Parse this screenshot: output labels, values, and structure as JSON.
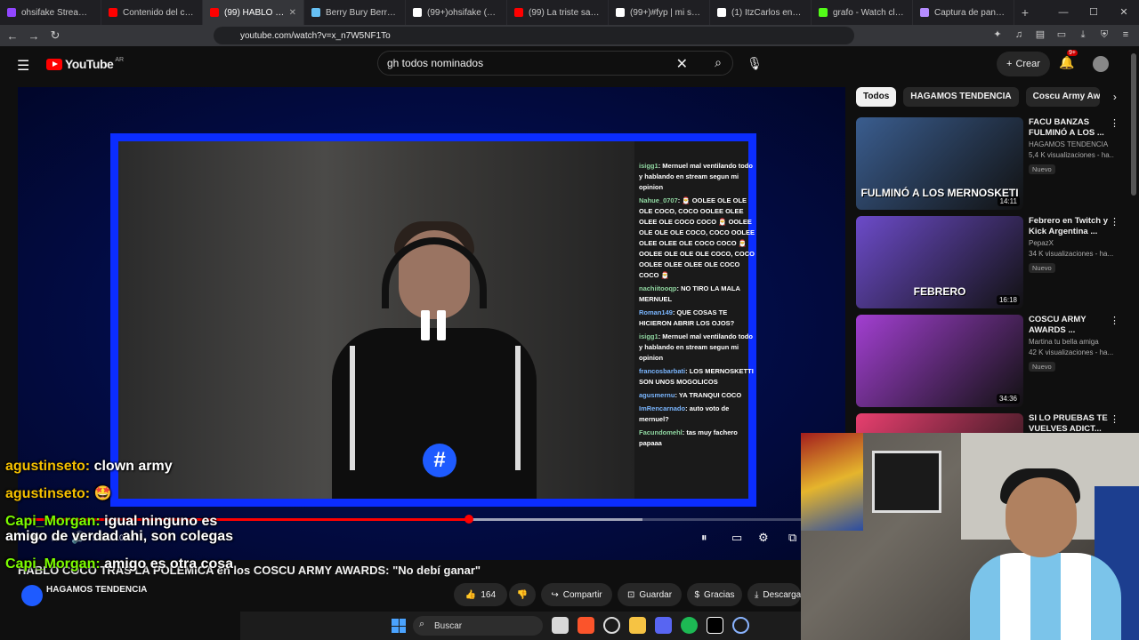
{
  "browser": {
    "tabs": [
      {
        "label": "ohsifake Stream - Y",
        "color": "#9146ff"
      },
      {
        "label": "Contenido del canal -",
        "color": "#ff0000"
      },
      {
        "label": "(99) HABLÓ CO",
        "color": "#ff0000",
        "active": true
      },
      {
        "label": "Berry Bury Berry en Ste",
        "color": "#66c0f4"
      },
      {
        "label": "(99+)ohsifake (@ohsifa",
        "color": "#ffffff"
      },
      {
        "label": "(99) La triste salida de",
        "color": "#ff0000"
      },
      {
        "label": "(99+)#fyp | mi sueño c",
        "color": "#ffffff"
      },
      {
        "label": "(1) ItzCarlos en X: \"Yo",
        "color": "#ffffff"
      },
      {
        "label": "grafo - Watch clips on",
        "color": "#53fc18"
      },
      {
        "label": "Captura de pantalla pc",
        "color": "#b58cff"
      }
    ],
    "new_tab": "+",
    "url": "youtube.com/watch?v=x_n7W5NF1To"
  },
  "yt": {
    "logo_text": "YouTube",
    "country": "AR",
    "search_value": "gh todos nominados",
    "create_label": "Crear",
    "notif_count": "9+"
  },
  "player": {
    "current_time": "5:29",
    "duration": "10:03",
    "time_display": "5:29 / 10:03",
    "progress_fraction": 0.546,
    "loaded_fraction": 0.76,
    "overlay_chat": [
      {
        "user": "isigg1",
        "text": ": Mernuel mal ventilando todo y hablando en stream segun mi opinion"
      },
      {
        "user": "Nahue_0707",
        "text": ": 🎅 OOLEE OLE OLE OLE COCO, COCO OOLEE OLEE OLEE OLE COCO COCO 🎅 OOLEE OLE OLE OLE COCO, COCO OOLEE OLEE OLEE OLE COCO COCO 🎅 OOLEE OLE OLE OLE COCO, COCO OOLEE OLEE OLEE OLE COCO COCO 🎅"
      },
      {
        "user": "nachiitooqp",
        "text": ": NO TIRO LA MALA MERNUEL"
      },
      {
        "user": "Roman149",
        "text": ": QUE COSAS TE HICIERON ABRIR LOS OJOS?",
        "blue": true
      },
      {
        "user": "isigg1",
        "text": ": Mernuel mal ventilando todo y hablando en stream segun mi opinion"
      },
      {
        "user": "francosbarbati",
        "text": ": LOS MERNOSKETTI SON UNOS MOGOLICOS",
        "blue": true
      },
      {
        "user": "agusmernu",
        "text": ": YA TRANQUI COCO",
        "blue": true
      },
      {
        "user": "ImRencarnado",
        "text": ": auto voto de mernuel?",
        "blue": true
      },
      {
        "user": "Facundomehl",
        "text": ": tas muy fachero papaaa"
      }
    ]
  },
  "video": {
    "title": "HABLÓ COCO TRAS LA POLÉMICA en los COSCU ARMY AWARDS: \"No debí ganar\"",
    "channel": "HAGAMOS TENDENCIA",
    "likes": "164",
    "share": "Compartir",
    "save": "Guardar",
    "thanks": "Gracias",
    "download": "Descargar"
  },
  "chips": [
    "Todos",
    "HAGAMOS TENDENCIA",
    "Coscu Army Awards"
  ],
  "recommendations": [
    {
      "title": "FACU BANZAS FULMINÓ A LOS ...",
      "channel": "HAGAMOS TENDENCIA",
      "meta": "5,4 K visualizaciones - ha...",
      "badge": "Nuevo",
      "duration": "14:11",
      "caption": "FULMINÓ A LOS MERNOSKETI",
      "bg": "#3a5d8f"
    },
    {
      "title": "Febrero en Twitch y Kick Argentina ...",
      "channel": "PepazX",
      "meta": "34 K visualizaciones - ha...",
      "badge": "Nuevo",
      "duration": "16:18",
      "caption": "FEBRERO",
      "bg": "#6c4bc9"
    },
    {
      "title": "COSCU ARMY AWARDS ...",
      "channel": "Martina tu bella amiga",
      "meta": "42 K visualizaciones - ha...",
      "badge": "Nuevo",
      "duration": "34:36",
      "caption": "",
      "bg": "#a23fd1"
    },
    {
      "title": "SI LO PRUEBAS TE VUELVES ADICT...",
      "channel": "",
      "meta": "",
      "badge": "",
      "duration": "",
      "caption": "",
      "bg": "#e83f6f"
    }
  ],
  "stream_chat": [
    {
      "user": "agustinseto",
      "text": "clown army",
      "color": "gold"
    },
    {
      "user": "agustinseto",
      "text": "🤩",
      "color": "gold"
    },
    {
      "user": "Capi_Morgan",
      "text": "igual ninguno es amigo de verdad ahi, son colegas",
      "color": "green"
    },
    {
      "user": "Capi_Morgan",
      "text": "amigo es otra cosa",
      "color": "green"
    }
  ],
  "taskbar": {
    "search_placeholder": "Buscar"
  }
}
